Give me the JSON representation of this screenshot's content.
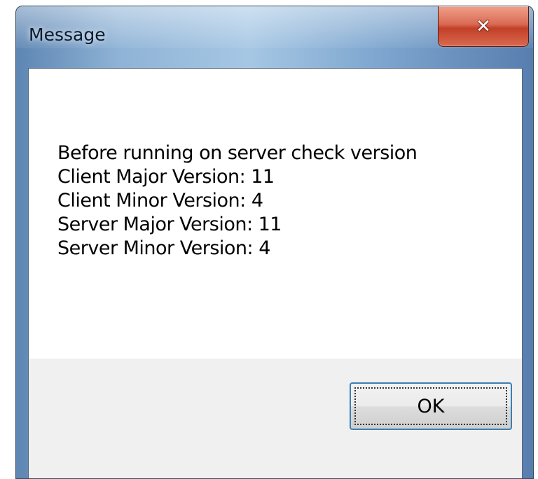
{
  "window": {
    "title": "Message",
    "close_icon": "close-icon"
  },
  "message": {
    "lines": [
      "Before running on server check version",
      "Client Major Version: 11",
      "Client Minor Version: 4",
      "Server Major Version: 11",
      "Server Minor Version: 4"
    ]
  },
  "buttons": {
    "ok_label": "OK"
  },
  "colors": {
    "title_bar": "#8fb3d6",
    "close_button": "#c33f27",
    "button_area": "#f0f0f0",
    "ok_focus_border": "#3c7fb1"
  }
}
